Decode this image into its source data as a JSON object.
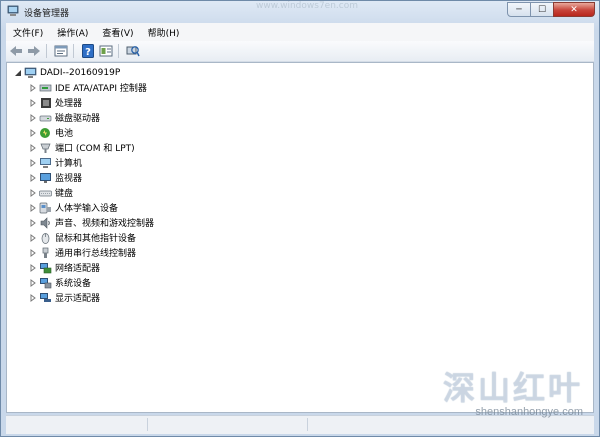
{
  "window": {
    "title": "设备管理器",
    "faint_url": "www.windows7en.com"
  },
  "caption_buttons": {
    "minimize": "─",
    "maximize": "☐",
    "close": "✕"
  },
  "menu": [
    {
      "label": "文件(F)"
    },
    {
      "label": "操作(A)"
    },
    {
      "label": "查看(V)"
    },
    {
      "label": "帮助(H)"
    }
  ],
  "toolbar": [
    {
      "name": "back-icon"
    },
    {
      "name": "forward-icon"
    },
    {
      "name": "properties-icon"
    },
    {
      "name": "help-icon"
    },
    {
      "name": "view-icon"
    },
    {
      "name": "scan-hardware-icon"
    }
  ],
  "tree": {
    "root": {
      "label": "DADI--20160919P",
      "icon": "computer-icon",
      "expanded": true
    },
    "children": [
      {
        "label": "IDE ATA/ATAPI 控制器",
        "icon": "ide-controller-icon"
      },
      {
        "label": "处理器",
        "icon": "processor-icon"
      },
      {
        "label": "磁盘驱动器",
        "icon": "disk-drive-icon"
      },
      {
        "label": "电池",
        "icon": "battery-icon"
      },
      {
        "label": "端口 (COM 和 LPT)",
        "icon": "port-icon"
      },
      {
        "label": "计算机",
        "icon": "computer-icon"
      },
      {
        "label": "监视器",
        "icon": "monitor-icon"
      },
      {
        "label": "键盘",
        "icon": "keyboard-icon"
      },
      {
        "label": "人体学输入设备",
        "icon": "hid-icon"
      },
      {
        "label": "声音、视频和游戏控制器",
        "icon": "sound-icon"
      },
      {
        "label": "鼠标和其他指针设备",
        "icon": "mouse-icon"
      },
      {
        "label": "通用串行总线控制器",
        "icon": "usb-icon"
      },
      {
        "label": "网络适配器",
        "icon": "network-icon"
      },
      {
        "label": "系统设备",
        "icon": "system-device-icon"
      },
      {
        "label": "显示适配器",
        "icon": "display-adapter-icon"
      }
    ]
  },
  "watermark": {
    "logo_text": "深山红叶",
    "url": "shenshanhongye.com"
  }
}
